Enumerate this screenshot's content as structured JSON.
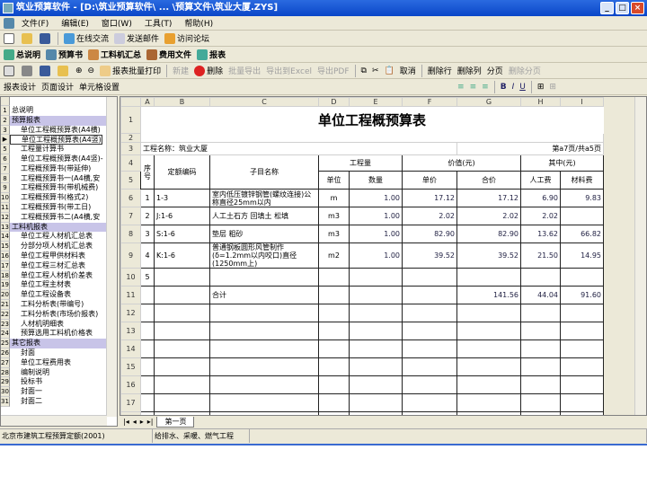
{
  "window": {
    "title": "筑业预算软件 - [D:\\筑业预算软件\\ ... \\预算文件\\筑业大厦.ZYS]"
  },
  "menu": [
    "文件(F)",
    "编辑(E)",
    "窗口(W)",
    "工具(T)",
    "帮助(H)"
  ],
  "toolbar1": [
    "在线交流",
    "发送邮件",
    "访问论坛"
  ],
  "toolbar2": [
    "总说明",
    "预算书",
    "工料机汇总",
    "费用文件",
    "报表"
  ],
  "toolbar3": {
    "batch_print": "报表批量打印",
    "new": "新建",
    "delete": "删除",
    "batch_export": "批量导出",
    "export_excel": "导出到Excel",
    "export_pdf": "导出PDF",
    "cancel": "取消",
    "del_row": "删除行",
    "del_col": "删除列",
    "page_break": "分页",
    "del_page_break": "删除分页"
  },
  "design_bar": [
    "报表设计",
    "页面设计",
    "单元格设置"
  ],
  "format_bar": {
    "bold": "B",
    "italic": "I",
    "underline": "U"
  },
  "tree": [
    {
      "n": "1",
      "label": "总说明",
      "type": "top"
    },
    {
      "n": "2",
      "label": "预算报表",
      "type": "grp"
    },
    {
      "n": "3",
      "label": "单位工程概预算表(A4横)",
      "type": "sub"
    },
    {
      "n": "▶",
      "label": "单位工程概预算表(A4竖)",
      "type": "sel"
    },
    {
      "n": "5",
      "label": "工程量计算书",
      "type": "sub"
    },
    {
      "n": "6",
      "label": "单位工程概预算表(A4竖)-",
      "type": "sub"
    },
    {
      "n": "7",
      "label": "工程概预算书(带延伸)",
      "type": "sub"
    },
    {
      "n": "8",
      "label": "工程概预算书一(A4横,安",
      "type": "sub"
    },
    {
      "n": "9",
      "label": "工程概预算书(带机械费)",
      "type": "sub"
    },
    {
      "n": "10",
      "label": "工程概预算书(格式2)",
      "type": "sub"
    },
    {
      "n": "11",
      "label": "工程概预算书(带工日)",
      "type": "sub"
    },
    {
      "n": "12",
      "label": "工程概预算书二(A4横,安",
      "type": "sub"
    },
    {
      "n": "13",
      "label": "工料机报表",
      "type": "grp"
    },
    {
      "n": "14",
      "label": "单位工程人材机汇总表",
      "type": "sub"
    },
    {
      "n": "15",
      "label": "分部分项人材机汇总表",
      "type": "sub"
    },
    {
      "n": "16",
      "label": "单位工程甲供材料表",
      "type": "sub"
    },
    {
      "n": "17",
      "label": "单位工程三材汇总表",
      "type": "sub"
    },
    {
      "n": "18",
      "label": "单位工程人材机价差表",
      "type": "sub"
    },
    {
      "n": "19",
      "label": "单位工程主材表",
      "type": "sub"
    },
    {
      "n": "20",
      "label": "单位工程设备表",
      "type": "sub"
    },
    {
      "n": "21",
      "label": "工料分析表(带编号)",
      "type": "sub"
    },
    {
      "n": "22",
      "label": "工料分析表(市场价报表)",
      "type": "sub"
    },
    {
      "n": "23",
      "label": "人材机明细表",
      "type": "sub"
    },
    {
      "n": "24",
      "label": "预算选用工料机价格表",
      "type": "sub"
    },
    {
      "n": "25",
      "label": "其它报表",
      "type": "grp"
    },
    {
      "n": "26",
      "label": "封面",
      "type": "sub"
    },
    {
      "n": "27",
      "label": "单位工程费用表",
      "type": "sub"
    },
    {
      "n": "28",
      "label": "编制说明",
      "type": "sub"
    },
    {
      "n": "29",
      "label": "投标书",
      "type": "sub"
    },
    {
      "n": "30",
      "label": "封面一",
      "type": "sub"
    },
    {
      "n": "31",
      "label": "封面二",
      "type": "sub"
    }
  ],
  "sheet": {
    "col_headers": [
      "A",
      "B",
      "C",
      "D",
      "E",
      "F",
      "G",
      "H",
      "I"
    ],
    "title": "单位工程概预算表",
    "project": "工程名称：筑业大厦",
    "page": "第a7页/共a5页",
    "h": {
      "seq": "序号",
      "code": "定额编码",
      "name": "子目名称",
      "qty": "工程量",
      "unit": "单位",
      "amount": "数量",
      "value": "价值(元)",
      "price": "单价",
      "total": "合价",
      "of": "其中(元)",
      "labor": "人工费",
      "material": "材料费"
    },
    "rows": [
      {
        "seq": "1",
        "code": "1-3",
        "name": "室内低压镀锌钢管(螺纹连接)公称直径25mm以内",
        "unit": "m",
        "amount": "1.00",
        "price": "17.12",
        "total": "17.12",
        "labor": "6.90",
        "material": "9.83"
      },
      {
        "seq": "2",
        "code": "J:1-6",
        "name": "人工土石方 回填土 松填",
        "unit": "m3",
        "amount": "1.00",
        "price": "2.02",
        "total": "2.02",
        "labor": "2.02",
        "material": ""
      },
      {
        "seq": "3",
        "code": "S:1-6",
        "name": "垫层 粗砂",
        "unit": "m3",
        "amount": "1.00",
        "price": "82.90",
        "total": "82.90",
        "labor": "13.62",
        "material": "66.82"
      },
      {
        "seq": "4",
        "code": "K:1-6",
        "name": "普通钢板圆形风管制作(δ=1.2mm以内咬口)直径(1250mm上)",
        "unit": "m2",
        "amount": "1.00",
        "price": "39.52",
        "total": "39.52",
        "labor": "21.50",
        "material": "14.95"
      },
      {
        "seq": "5",
        "code": "",
        "name": "",
        "unit": "",
        "amount": "",
        "price": "",
        "total": "",
        "labor": "",
        "material": ""
      }
    ],
    "sum": {
      "label": "合计",
      "total": "141.56",
      "labor": "44.04",
      "material": "91.60"
    },
    "tab": "第一页"
  },
  "status": [
    "北京市建筑工程预算定额(2001)",
    "给排水、采暖、燃气工程"
  ]
}
